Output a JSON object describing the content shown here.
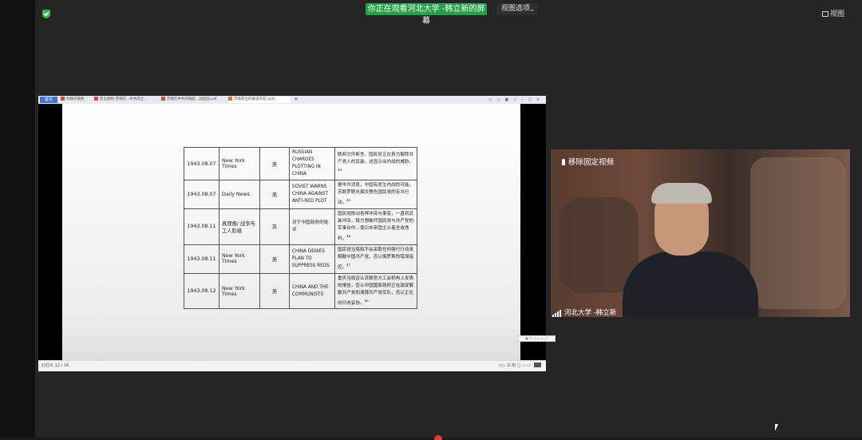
{
  "meeting": {
    "banner": "你正在观看河北大学 -韩立新的屏幕",
    "view_options": "视图选项",
    "view_button": "视图"
  },
  "viewer": {
    "tabs": [
      {
        "label": "首页",
        "active": false
      },
      {
        "label": "找稿壳模板",
        "active": false
      },
      {
        "label": "新出版物-苏俄在...中共的之...",
        "active": false
      },
      {
        "label": "苏俄在中共的崛起...战后国.pdf",
        "active": false
      },
      {
        "label": "苏俄新出的报道内容.pptx",
        "active": true
      }
    ],
    "status_left": "幻灯片 12 / 16",
    "status_right": "◁ ▷ ☰ 田 □ ▭ ▭"
  },
  "table": {
    "rows": [
      {
        "date": "1943.08.07",
        "source": "New York Times",
        "country": "美",
        "title": "RUSSIAN CHARGES PLOTTING IN CHINA",
        "summary": "联邦文件断言，国民党正在努力解除共产党人的武装，这显示出内战的威胁。",
        "note": "44"
      },
      {
        "date": "1943.08.07",
        "source": "Daily News",
        "country": "美",
        "title": "SOVIET WARNS CHINA AGAINST ANTI-RED PLOT",
        "summary": "据中共消息，中国有发生内战的可能，苏联罗斯夫撰文警告国民党的反共行动。",
        "note": "45"
      },
      {
        "date": "1943.08.11",
        "source": "真理报/ 战争与工人阶级",
        "country": "苏",
        "title": "对于中国政府的批评",
        "summary": "国民党挑动各种冲突与事变，一直到武装冲突，极力想破坏国民党与共产党的军事合作…使日本帝国主义者坐收渔利。",
        "note": "46"
      },
      {
        "date": "1943.08.11",
        "source": "New York Times",
        "country": "美",
        "title": "CHINA DENIES PLAN TO SUPPRESS REDS",
        "summary": "国民党当局和不会采取任何强行行动来解散中国共产党，否认俄罗斯的错误指控。",
        "note": "47"
      },
      {
        "date": "1943.08.12",
        "source": "New York Times",
        "country": "美",
        "title": "CHINA AND THE COMMUNISTS",
        "summary": "重庆当局否认苏联官方工会机构上发表的报告，否认中国国家政府正在敦促解散共产党和清算共产党军队，否认正在向日本妥协。",
        "note": "48"
      }
    ]
  },
  "video": {
    "unpin_label": "移除固定视频",
    "participant_name": "河北大学 -韩立新"
  }
}
